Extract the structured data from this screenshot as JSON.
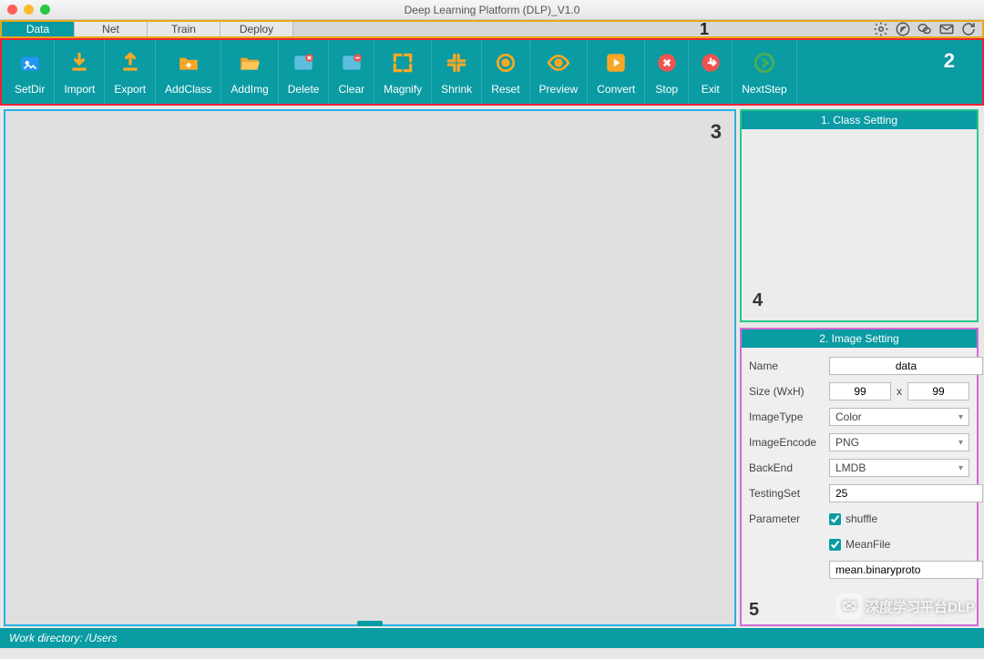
{
  "window": {
    "title": "Deep Learning Platform (DLP)_V1.0"
  },
  "traffic": {
    "close": "#ff5f57",
    "min": "#febc2e",
    "max": "#28c840"
  },
  "menus": {
    "items": [
      {
        "label": "Data",
        "active": true
      },
      {
        "label": "Net",
        "active": false
      },
      {
        "label": "Train",
        "active": false
      },
      {
        "label": "Deploy",
        "active": false
      }
    ],
    "annotation": "1"
  },
  "right_icons": [
    "gear-icon",
    "compass-icon",
    "wechat-icon",
    "mail-icon",
    "refresh-icon"
  ],
  "toolbar": {
    "annotation": "2",
    "items": [
      {
        "label": "SetDir",
        "icon": "folder-image",
        "color": "#f9a825"
      },
      {
        "label": "Import",
        "icon": "arrow-down-tray",
        "color": "#f9a825"
      },
      {
        "label": "Export",
        "icon": "arrow-up-tray",
        "color": "#f9a825"
      },
      {
        "label": "AddClass",
        "icon": "folder-plus",
        "color": "#f9a825"
      },
      {
        "label": "AddImg",
        "icon": "folder-open",
        "color": "#f9a825"
      },
      {
        "label": "Delete",
        "icon": "image-x",
        "color": "#ef5350"
      },
      {
        "label": "Clear",
        "icon": "image-clear",
        "color": "#ef5350"
      },
      {
        "label": "Magnify",
        "icon": "expand",
        "color": "#f9a825"
      },
      {
        "label": "Shrink",
        "icon": "shrink",
        "color": "#f9a825"
      },
      {
        "label": "Reset",
        "icon": "target",
        "color": "#f9a825"
      },
      {
        "label": "Preview",
        "icon": "eye",
        "color": "#f9a825"
      },
      {
        "label": "Convert",
        "icon": "play",
        "color": "#f9a825"
      },
      {
        "label": "Stop",
        "icon": "stop-x",
        "color": "#ef5350"
      },
      {
        "label": "Exit",
        "icon": "exit",
        "color": "#ef5350"
      },
      {
        "label": "NextStep",
        "icon": "arrow-right-circle",
        "color": "#4caf50"
      }
    ]
  },
  "canvas": {
    "annotation": "3"
  },
  "class_panel": {
    "title": "1. Class Setting",
    "annotation": "4"
  },
  "image_panel": {
    "title": "2. Image Setting",
    "annotation": "5",
    "fields": {
      "name_label": "Name",
      "name_value": "data",
      "size_label": "Size (WxH)",
      "size_w": "99",
      "size_x": "x",
      "size_h": "99",
      "imagetype_label": "ImageType",
      "imagetype_value": "Color",
      "imageencode_label": "ImageEncode",
      "imageencode_value": "PNG",
      "backend_label": "BackEnd",
      "backend_value": "LMDB",
      "testing_label": "TestingSet",
      "testing_value": "25",
      "testing_pct": "%",
      "param_label": "Parameter",
      "shuffle_label": "shuffle",
      "shuffle_checked": true,
      "meanfile_label": "MeanFile",
      "meanfile_checked": true,
      "meanfile_value": "mean.binaryproto"
    }
  },
  "watermark": "深度学习平台DLP",
  "status": {
    "text": "Work directory: /Users"
  }
}
